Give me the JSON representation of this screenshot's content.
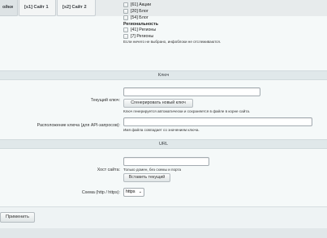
{
  "tabs": [
    {
      "label": "ойки"
    },
    {
      "label": "[s1] Сайт 1"
    },
    {
      "label": "[s2] Сайт 2"
    }
  ],
  "sections": {
    "items": [
      {
        "label": "[61] Акции"
      },
      {
        "label": "[20] Блог"
      },
      {
        "label": "[54] Блог"
      }
    ],
    "regionality_title": "Региональность",
    "regions": [
      {
        "label": "[41] Регионы"
      },
      {
        "label": "[7] Регионы"
      }
    ],
    "hint": "Если ничего не выбрано, инфоблоки не отслеживаются."
  },
  "key_section": {
    "title": "Ключ",
    "current_key_label": "Текущий ключ:",
    "generate_button": "Сгенерировать новый ключ",
    "generate_hint": "Ключ генерируется автоматически и сохраняется в файле в корне сайта.",
    "location_label": "Расположение ключа (для API-запросов):",
    "location_hint": "Имя файла совпадает со значением ключа."
  },
  "url_section": {
    "title": "URL",
    "host_label": "Хост сайта:",
    "host_hint": "Только домен, без схемы и порта",
    "insert_current_button": "Вставить текущий",
    "scheme_label": "Схема (http / https):",
    "scheme_value": "https"
  },
  "footer": {
    "apply_button": "Применить"
  }
}
